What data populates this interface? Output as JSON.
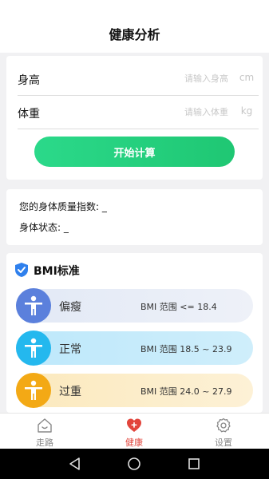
{
  "header": {
    "title": "健康分析"
  },
  "form": {
    "height": {
      "label": "身高",
      "placeholder": "请输入身高",
      "value": "",
      "unit": "cm"
    },
    "weight": {
      "label": "体重",
      "placeholder": "请输入体重",
      "value": "",
      "unit": "kg"
    },
    "calculate_label": "开始计算"
  },
  "result": {
    "bmi_label": "您的身体质量指数:",
    "bmi_value": "_",
    "status_label": "身体状态:",
    "status_value": "_"
  },
  "standard": {
    "title": "BMI标准",
    "icon": "shield-check-icon",
    "rows": [
      {
        "name": "偏瘦",
        "range": "BMI 范围 <= 18.4",
        "color": "#5b80dc",
        "icon": "person-icon"
      },
      {
        "name": "正常",
        "range": "BMI 范围 18.5 ~ 23.9",
        "color": "#24b8ee",
        "icon": "person-icon"
      },
      {
        "name": "过重",
        "range": "BMI 范围 24.0 ~ 27.9",
        "color": "#f3a915",
        "icon": "person-icon"
      }
    ]
  },
  "tabs": [
    {
      "label": "走路",
      "icon": "home-icon",
      "active": false
    },
    {
      "label": "健康",
      "icon": "heart-plus-icon",
      "active": true
    },
    {
      "label": "设置",
      "icon": "gear-icon",
      "active": false
    }
  ],
  "colors": {
    "accent": "#e2453c",
    "button": "#22cf7d",
    "shield": "#2f80ed"
  }
}
